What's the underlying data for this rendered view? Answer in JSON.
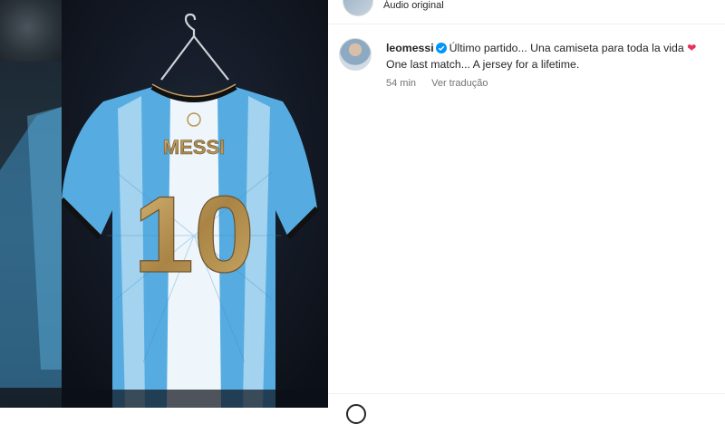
{
  "header": {
    "audio_label": "Áudio original"
  },
  "post": {
    "username": "leomessi",
    "verified": true,
    "caption_es": "Último partido... Una camiseta para toda la vida",
    "caption_heart": "❤",
    "caption_en": "One last match... A jersey for a lifetime.",
    "time_ago": "54 min",
    "see_translation": "Ver tradução"
  },
  "media": {
    "jersey_name": "MESSI",
    "jersey_number": "10"
  },
  "colors": {
    "jersey_blue": "#4ea8e0",
    "jersey_white": "#eef6fb",
    "gold": "#b99552",
    "verified_blue": "#0095f6",
    "heart": "#e8325a"
  }
}
